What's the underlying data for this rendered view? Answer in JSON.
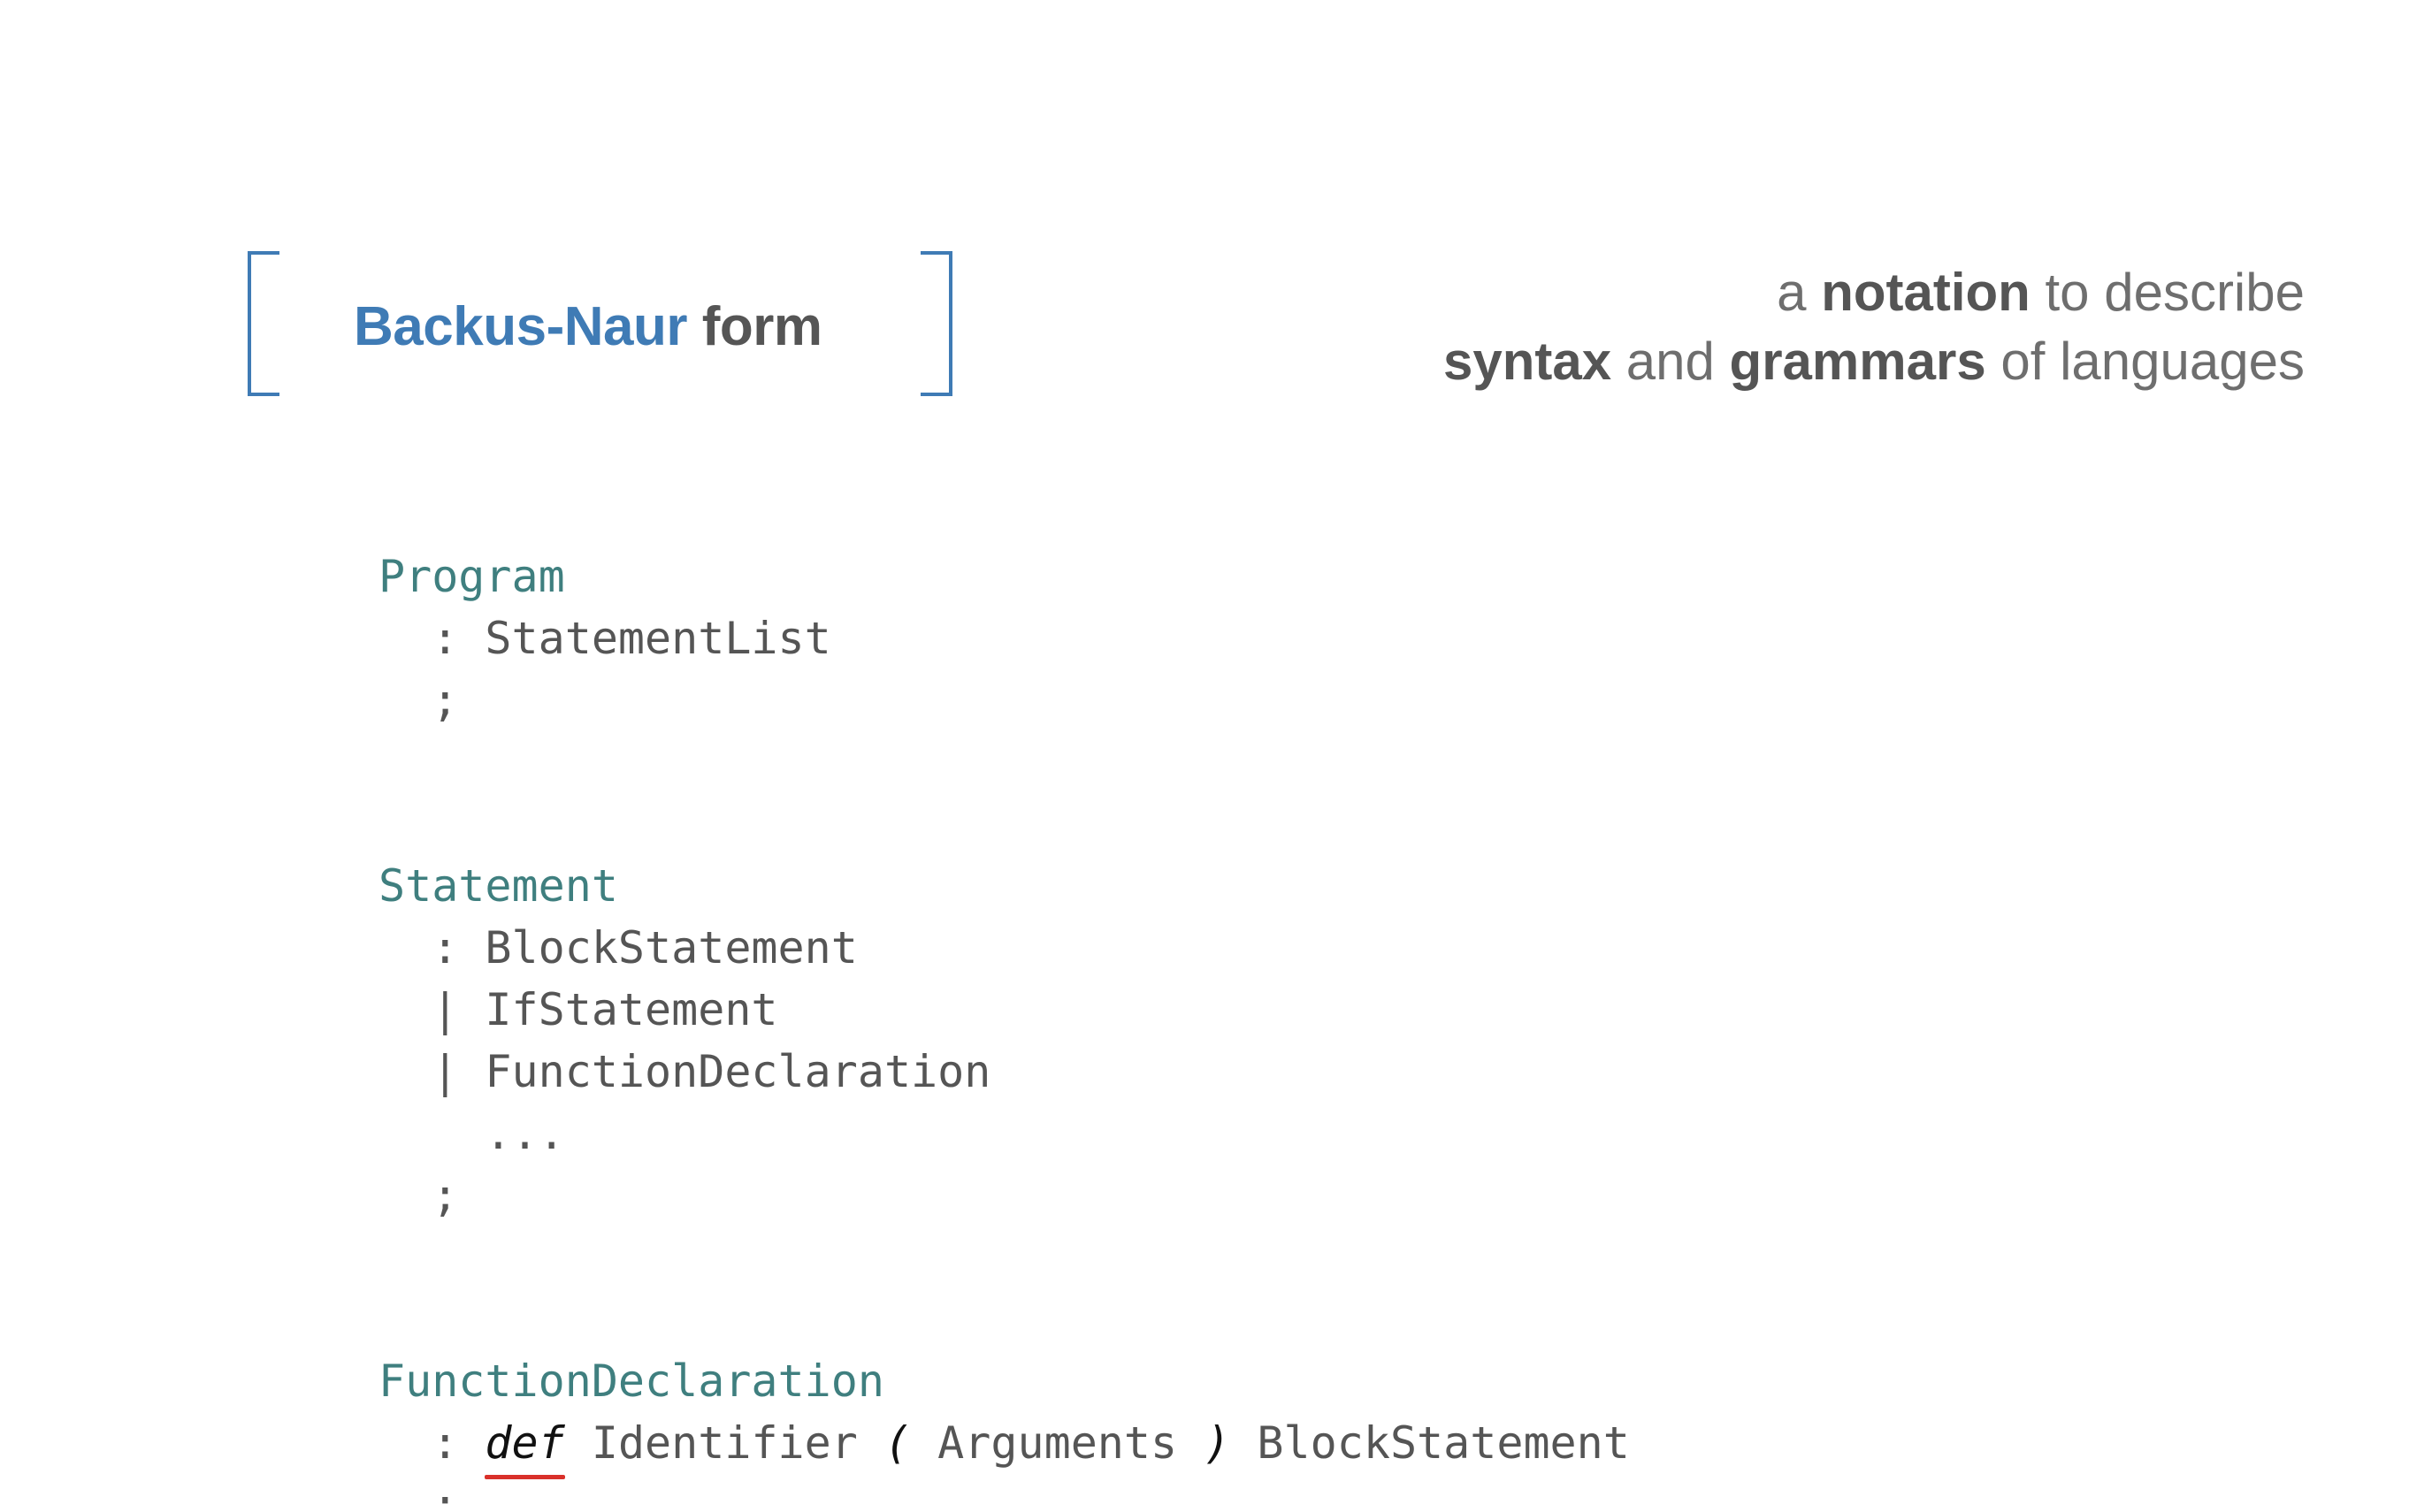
{
  "title": {
    "accent": "Backus-Naur",
    "rest": " form"
  },
  "tagline": {
    "line1": [
      {
        "text": "a ",
        "bold": false
      },
      {
        "text": "notation",
        "bold": true
      },
      {
        "text": " to describe",
        "bold": false
      }
    ],
    "line2": [
      {
        "text": "syntax",
        "bold": true
      },
      {
        "text": " and ",
        "bold": false
      },
      {
        "text": "grammars",
        "bold": true
      },
      {
        "text": " of languages",
        "bold": false
      }
    ]
  },
  "grammar": {
    "program": {
      "name": "Program",
      "lines": [
        "  : StatementList",
        "  ;"
      ]
    },
    "statement": {
      "name": "Statement",
      "lines": [
        "  : BlockStatement",
        "  | IfStatement",
        "  | FunctionDeclaration",
        "    ...",
        "  ;"
      ]
    },
    "function_declaration": {
      "name": "FunctionDeclaration",
      "prefix": "  : ",
      "keyword": "def",
      "identifier": " Identifier ",
      "open_paren": "(",
      "arguments": " Arguments ",
      "close_paren": ")",
      "block": " BlockStatement",
      "end": "  ;"
    }
  },
  "colors": {
    "accent": "#3f7bb5",
    "rule_name": "#3f7f7f",
    "text": "#555555",
    "underline": "#d9302a"
  }
}
